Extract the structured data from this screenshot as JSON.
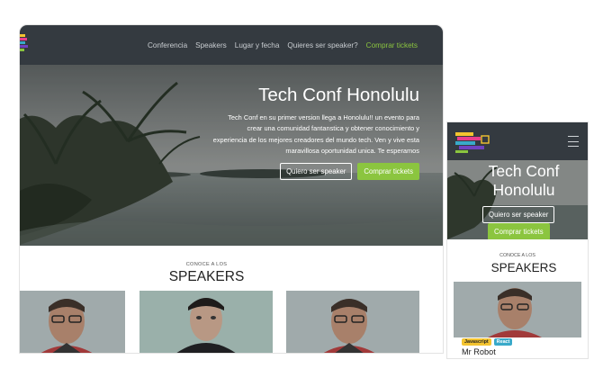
{
  "nav": {
    "items": [
      "Conferencia",
      "Speakers",
      "Lugar y fecha",
      "Quieres ser speaker?"
    ],
    "buy_label": "Comprar tickets"
  },
  "hero": {
    "title": "Tech Conf Honolulu",
    "description": "Tech Conf en su primer version llega a Honolulu!! un evento para crear una comunidad fantanstica y obtener conocimiento y experiencia de los mejores creadores del mundo tech. Ven y vive esta maravillosa oportunidad unica. Te esperamos",
    "speaker_button": "Quiero ser speaker",
    "tickets_button": "Comprar tickets"
  },
  "speakers": {
    "kicker": "CONOCE A LOS",
    "heading": "SPEAKERS"
  },
  "mobile": {
    "title": "Tech Conf Honolulu",
    "speaker_button": "Quiero ser speaker",
    "tickets_button": "Comprar tickets",
    "kicker": "CONOCE A LOS",
    "heading": "SPEAKERS",
    "card": {
      "tags": [
        "Javascript",
        "React"
      ],
      "name": "Mr Robot"
    }
  },
  "colors": {
    "navbar": "#343a40",
    "accent_green": "#8bc53f",
    "tag_javascript": "#f4c430",
    "tag_react": "#39a9c9"
  },
  "icons": [
    "logo-icon",
    "hamburger-icon"
  ]
}
